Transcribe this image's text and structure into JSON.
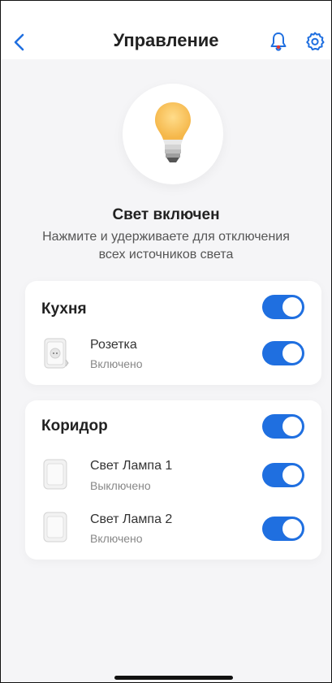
{
  "header": {
    "title": "Управление"
  },
  "status": {
    "title": "Свет включен",
    "subtitle": "Нажмите и удерживаете для отключения всех источников света"
  },
  "groups": [
    {
      "name": "Кухня",
      "on": true,
      "devices": [
        {
          "name": "Розетка",
          "state": "Включено",
          "icon": "socket-icon",
          "on": true
        }
      ]
    },
    {
      "name": "Коридор",
      "on": true,
      "devices": [
        {
          "name": "Свет Лампа 1",
          "state": "Выключено",
          "icon": "switch-icon",
          "on": true
        },
        {
          "name": "Свет Лампа 2",
          "state": "Включено",
          "icon": "switch-icon",
          "on": true
        }
      ]
    }
  ],
  "colors": {
    "accent": "#1f6fe0",
    "background": "#f5f5f7",
    "bulb_glow": "#f8c35a"
  }
}
